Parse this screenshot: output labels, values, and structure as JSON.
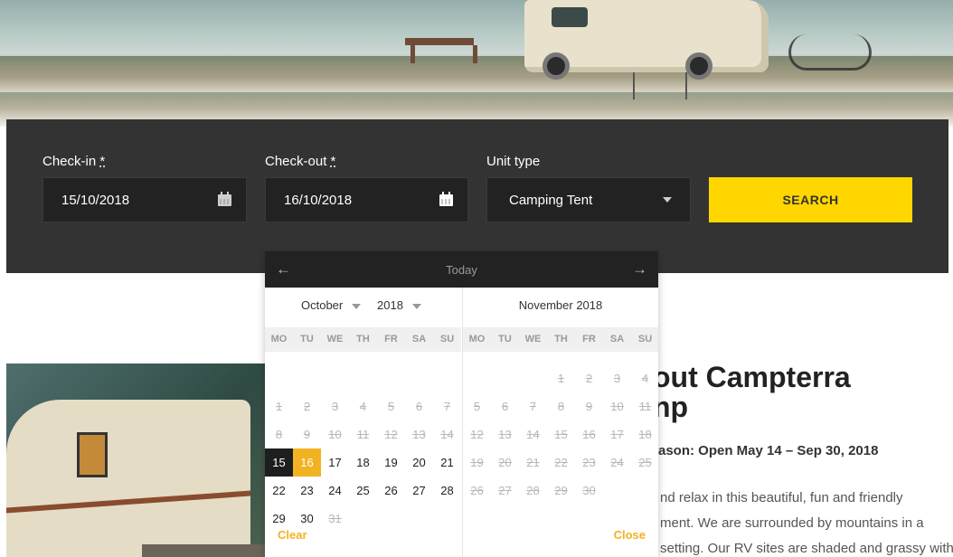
{
  "booking": {
    "checkin_label": "Check-in",
    "checkout_label": "Check-out",
    "required_mark": "*",
    "unit_type_label": "Unit type",
    "checkin_value": "15/10/2018",
    "checkout_value": "16/10/2018",
    "unit_type_value": "Camping Tent",
    "search_label": "SEARCH",
    "calendar_icon": "calendar-icon",
    "accent_color": "#ffd600"
  },
  "datepicker": {
    "prev_arrow": "←",
    "next_arrow": "→",
    "today_label": "Today",
    "clear_label": "Clear",
    "close_label": "Close",
    "weekdays": [
      "MO",
      "TU",
      "WE",
      "TH",
      "FR",
      "SA",
      "SU"
    ],
    "selected_color": "#1e1e1e",
    "highlight_color": "#f2b322",
    "left_month": {
      "month_select": "October",
      "year_select": "2018",
      "weeks": [
        [
          null,
          null,
          null,
          null,
          null,
          null,
          null
        ],
        [
          {
            "d": "1",
            "s": "disabled"
          },
          {
            "d": "2",
            "s": "disabled"
          },
          {
            "d": "3",
            "s": "disabled"
          },
          {
            "d": "4",
            "s": "disabled"
          },
          {
            "d": "5",
            "s": "disabled"
          },
          {
            "d": "6",
            "s": "disabled"
          },
          {
            "d": "7",
            "s": "disabled"
          }
        ],
        [
          {
            "d": "8",
            "s": "disabled"
          },
          {
            "d": "9",
            "s": "disabled"
          },
          {
            "d": "10",
            "s": "disabled"
          },
          {
            "d": "11",
            "s": "disabled"
          },
          {
            "d": "12",
            "s": "disabled"
          },
          {
            "d": "13",
            "s": "disabled"
          },
          {
            "d": "14",
            "s": "disabled"
          }
        ],
        [
          {
            "d": "15",
            "s": "selected"
          },
          {
            "d": "16",
            "s": "hl"
          },
          {
            "d": "17",
            "s": ""
          },
          {
            "d": "18",
            "s": ""
          },
          {
            "d": "19",
            "s": ""
          },
          {
            "d": "20",
            "s": ""
          },
          {
            "d": "21",
            "s": ""
          }
        ],
        [
          {
            "d": "22",
            "s": ""
          },
          {
            "d": "23",
            "s": ""
          },
          {
            "d": "24",
            "s": ""
          },
          {
            "d": "25",
            "s": ""
          },
          {
            "d": "26",
            "s": ""
          },
          {
            "d": "27",
            "s": ""
          },
          {
            "d": "28",
            "s": ""
          }
        ],
        [
          {
            "d": "29",
            "s": ""
          },
          {
            "d": "30",
            "s": ""
          },
          {
            "d": "31",
            "s": "disabled"
          },
          null,
          null,
          null,
          null
        ]
      ]
    },
    "right_month": {
      "title": "November 2018",
      "weeks": [
        [
          null,
          null,
          null,
          {
            "d": "1",
            "s": "disabled"
          },
          {
            "d": "2",
            "s": "disabled"
          },
          {
            "d": "3",
            "s": "disabled"
          },
          {
            "d": "4",
            "s": "disabled"
          }
        ],
        [
          {
            "d": "5",
            "s": "disabled"
          },
          {
            "d": "6",
            "s": "disabled"
          },
          {
            "d": "7",
            "s": "disabled"
          },
          {
            "d": "8",
            "s": "disabled"
          },
          {
            "d": "9",
            "s": "disabled"
          },
          {
            "d": "10",
            "s": "disabled"
          },
          {
            "d": "11",
            "s": "disabled"
          }
        ],
        [
          {
            "d": "12",
            "s": "disabled"
          },
          {
            "d": "13",
            "s": "disabled"
          },
          {
            "d": "14",
            "s": "disabled"
          },
          {
            "d": "15",
            "s": "disabled"
          },
          {
            "d": "16",
            "s": "disabled"
          },
          {
            "d": "17",
            "s": "disabled"
          },
          {
            "d": "18",
            "s": "disabled"
          }
        ],
        [
          {
            "d": "19",
            "s": "disabled"
          },
          {
            "d": "20",
            "s": "disabled"
          },
          {
            "d": "21",
            "s": "disabled"
          },
          {
            "d": "22",
            "s": "disabled"
          },
          {
            "d": "23",
            "s": "disabled"
          },
          {
            "d": "24",
            "s": "disabled"
          },
          {
            "d": "25",
            "s": "disabled"
          }
        ],
        [
          {
            "d": "26",
            "s": "disabled"
          },
          {
            "d": "27",
            "s": "disabled"
          },
          {
            "d": "28",
            "s": "disabled"
          },
          {
            "d": "29",
            "s": "disabled"
          },
          {
            "d": "30",
            "s": "disabled"
          },
          null,
          null
        ]
      ]
    }
  },
  "about": {
    "title_line1": "out Campterra",
    "title_line2": "np",
    "season": "ason: Open May 14 – Sep 30, 2018",
    "paragraph_lines": [
      "nd relax in this beautiful, fun and friendly",
      "ment. We are surrounded by mountains in a",
      "setting. Our RV sites are shaded and grassy with"
    ]
  }
}
